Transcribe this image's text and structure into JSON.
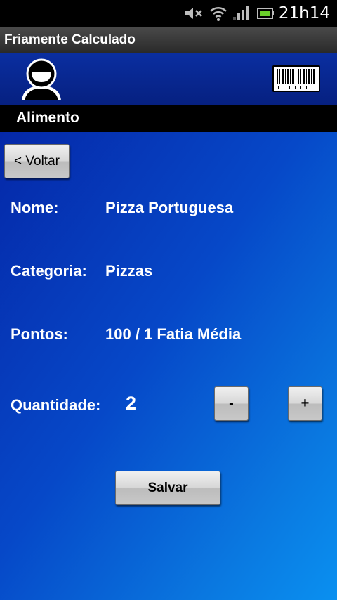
{
  "status_bar": {
    "time": "21h14",
    "icons": [
      "mute-icon",
      "wifi-icon",
      "signal-icon",
      "battery-icon"
    ]
  },
  "app": {
    "title": "Friamente Calculado"
  },
  "header": {
    "avatar_icon": "user-avatar-icon",
    "barcode_icon": "barcode-icon"
  },
  "section": {
    "title": "Alimento"
  },
  "back_button": {
    "label": "< Voltar"
  },
  "fields": {
    "nome": {
      "label": "Nome:",
      "value": "Pizza Portuguesa"
    },
    "categoria": {
      "label": "Categoria:",
      "value": "Pizzas"
    },
    "pontos": {
      "label": "Pontos:",
      "value": "100 / 1 Fatia Média"
    },
    "quantidade": {
      "label": "Quantidade:",
      "value": "2"
    }
  },
  "stepper": {
    "minus_label": "-",
    "plus_label": "+"
  },
  "save_button": {
    "label": "Salvar"
  },
  "colors": {
    "header_blue": "#0a2ea0",
    "content_gradient_start": "#0528a8",
    "content_gradient_end": "#0a90f0"
  }
}
